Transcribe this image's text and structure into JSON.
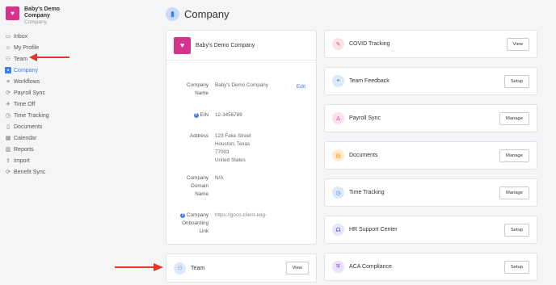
{
  "org": {
    "name_line1": "Baby's Demo",
    "name_line2": "Company",
    "subtitle": "Company"
  },
  "sidebar": {
    "items": [
      {
        "label": "Inbox",
        "icon": "inbox-icon"
      },
      {
        "label": "My Profile",
        "icon": "user-icon"
      },
      {
        "label": "Team",
        "icon": "team-icon"
      },
      {
        "label": "Company",
        "icon": "company-icon"
      },
      {
        "label": "Workflows",
        "icon": "workflows-icon"
      },
      {
        "label": "Payroll Sync",
        "icon": "sync-icon"
      },
      {
        "label": "Time Off",
        "icon": "plane-icon"
      },
      {
        "label": "Time Tracking",
        "icon": "clock-icon"
      },
      {
        "label": "Documents",
        "icon": "document-icon"
      },
      {
        "label": "Calendar",
        "icon": "calendar-icon"
      },
      {
        "label": "Reports",
        "icon": "chart-icon"
      },
      {
        "label": "Import",
        "icon": "upload-icon"
      },
      {
        "label": "Benefit Sync",
        "icon": "sync-icon"
      }
    ],
    "active": "Company"
  },
  "page": {
    "title": "Company"
  },
  "company_card": {
    "name": "Baby's Demo Company",
    "edit_label": "Edit",
    "fields": {
      "company_name_label_l1": "Company",
      "company_name_label_l2": "Name",
      "company_name_value": "Baby's Demo Company",
      "ein_label": "EIN",
      "ein_value": "12-3456789",
      "address_label": "Address",
      "address_l1": "123 Fake Street",
      "address_l2": "Houston, Texas",
      "address_l3": "77003",
      "address_l4": "United States",
      "domain_label_l1": "Company",
      "domain_label_l2": "Domain",
      "domain_label_l3": "Name",
      "domain_value": "N/A",
      "onboard_label_l1": "Company",
      "onboard_label_l2": "Onboarding",
      "onboard_label_l3": "Link",
      "onboard_value": "https://goco-client-edg-"
    }
  },
  "team_card": {
    "label": "Team",
    "button": "View"
  },
  "services": [
    {
      "label": "COVID Tracking",
      "button": "View",
      "icon": "syringe-icon",
      "bg": "#fbe3e3",
      "fg": "#e0565b"
    },
    {
      "label": "Team Feedback",
      "button": "Setup",
      "icon": "chat-icon",
      "bg": "#dce8fb",
      "fg": "#3d7fe6"
    },
    {
      "label": "Payroll Sync",
      "button": "Manage",
      "icon": "person-icon",
      "bg": "#fbe0ee",
      "fg": "#d6338f"
    },
    {
      "label": "Documents",
      "button": "Manage",
      "icon": "document-icon",
      "bg": "#fdeccf",
      "fg": "#f0a020"
    },
    {
      "label": "Time Tracking",
      "button": "Manage",
      "icon": "clock-icon",
      "bg": "#dce8fb",
      "fg": "#3d7fe6"
    },
    {
      "label": "HR Support Center",
      "button": "Setup",
      "icon": "headset-icon",
      "bg": "#e4e6fb",
      "fg": "#4a55c9"
    },
    {
      "label": "ACA Compliance",
      "button": "Setup",
      "icon": "shield-icon",
      "bg": "#ece0fb",
      "fg": "#8a4ad9"
    }
  ],
  "colors": {
    "accent": "#3d7fe6",
    "brand": "#d6338f",
    "arrow": "#e0392b"
  }
}
